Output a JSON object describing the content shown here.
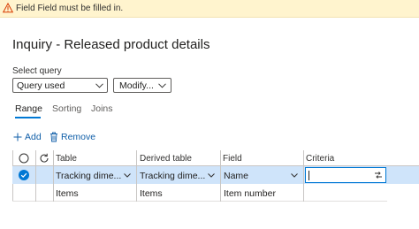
{
  "warning": {
    "message": "Field Field must be filled in."
  },
  "page": {
    "title": "Inquiry - Released product details"
  },
  "query": {
    "label": "Select query",
    "selected": "Query used",
    "modify_label": "Modify..."
  },
  "tabs": [
    {
      "label": "Range",
      "active": true
    },
    {
      "label": "Sorting",
      "active": false
    },
    {
      "label": "Joins",
      "active": false
    }
  ],
  "toolbar": {
    "add_label": "Add",
    "remove_label": "Remove"
  },
  "grid": {
    "columns": [
      "Table",
      "Derived table",
      "Field",
      "Criteria"
    ],
    "rows": [
      {
        "selected": true,
        "table": "Tracking dime...",
        "derived_table": "Tracking dime...",
        "field": "Name",
        "criteria": ""
      },
      {
        "selected": false,
        "table": "Items",
        "derived_table": "Items",
        "field": "Item number",
        "criteria": ""
      }
    ]
  },
  "colors": {
    "accent": "#0078d4",
    "warning_bg": "#fff4ce",
    "selected_row": "#cfe4fa"
  }
}
